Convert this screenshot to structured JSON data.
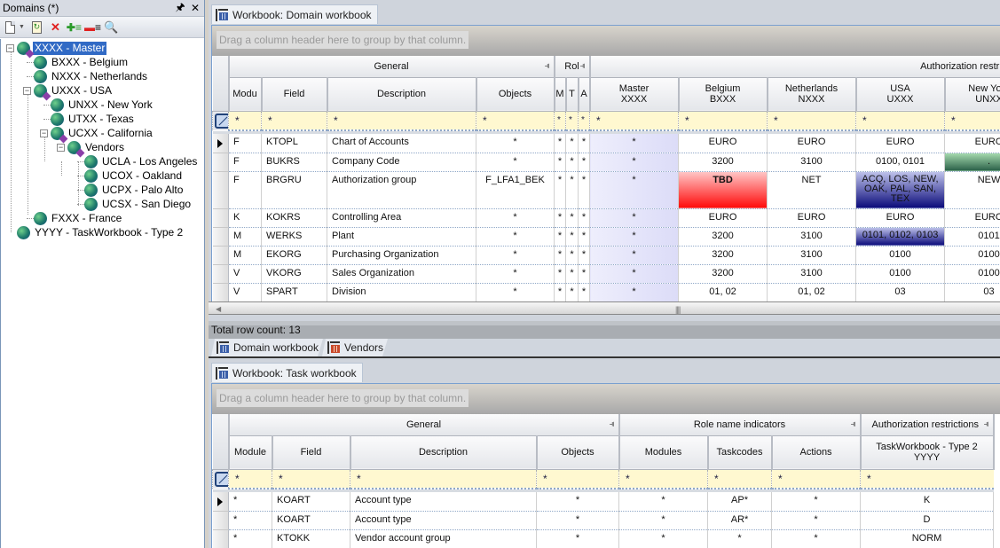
{
  "left_panel": {
    "title": "Domains (*)",
    "pin_label": "⊣",
    "close_label": "✕",
    "toolbar": [
      {
        "name": "new-button",
        "icon": "new-document-icon"
      },
      {
        "name": "refresh-button",
        "icon": "refresh-icon"
      },
      {
        "name": "delete-button",
        "icon": "delete-icon"
      },
      {
        "name": "add-button",
        "icon": "add-list-icon"
      },
      {
        "name": "remove-button",
        "icon": "remove-list-icon"
      },
      {
        "name": "inspect-button",
        "icon": "inspect-icon"
      }
    ],
    "tree": [
      {
        "label": "XXXX - Master",
        "level": 0,
        "expanded": true,
        "folder": true,
        "selected": true
      },
      {
        "label": "BXXX - Belgium",
        "level": 1
      },
      {
        "label": "NXXX - Netherlands",
        "level": 1
      },
      {
        "label": "UXXX - USA",
        "level": 1,
        "expanded": true,
        "folder": true
      },
      {
        "label": "UNXX - New York",
        "level": 2
      },
      {
        "label": "UTXX - Texas",
        "level": 2
      },
      {
        "label": "UCXX - California",
        "level": 2,
        "expanded": true,
        "folder": true
      },
      {
        "label": "Vendors",
        "level": 3,
        "expanded": true,
        "folder": true
      },
      {
        "label": "UCLA - Los Angeles",
        "level": 4
      },
      {
        "label": "UCOX - Oakland",
        "level": 4
      },
      {
        "label": "UCPX - Palo Alto",
        "level": 4
      },
      {
        "label": "UCSX - San Diego",
        "level": 4
      },
      {
        "label": "FXXX - France",
        "level": 1
      },
      {
        "label": "YYYY - TaskWorkbook - Type 2",
        "level": 0
      }
    ]
  },
  "domain_workbook": {
    "tab_label": "Workbook: Domain workbook",
    "group_hint": "Drag a column header here to group by that column.",
    "groups": {
      "general": "General",
      "roles": "Rol",
      "auth": "Authorization restrictions"
    },
    "columns": [
      "Modu",
      "Field",
      "Description",
      "Objects",
      "M",
      "T",
      "A",
      "Master\nXXXX",
      "Belgium\nBXXX",
      "Netherlands\nNXXX",
      "USA\nUXXX",
      "New York\nUNXX"
    ],
    "filter_value": "*",
    "rows": [
      {
        "cells": [
          "F",
          "KTOPL",
          "Chart of Accounts",
          "*",
          "*",
          "*",
          "*",
          "*",
          "EURO",
          "EURO",
          "EURO",
          "EURO"
        ],
        "current": true
      },
      {
        "cells": [
          "F",
          "BUKRS",
          "Company Code",
          "*",
          "*",
          "*",
          "*",
          "*",
          "3200",
          "3100",
          "0100, 0101",
          "."
        ]
      },
      {
        "cells": [
          "F",
          "BRGRU",
          "Authorization group",
          "F_LFA1_BEK",
          "*",
          "*",
          "*",
          "*",
          "TBD",
          "NET",
          "ACQ, LOS, NEW, OAK, PAL, SAN, TEX",
          "NEW"
        ]
      },
      {
        "cells": [
          "K",
          "KOKRS",
          "Controlling Area",
          "*",
          "*",
          "*",
          "*",
          "*",
          "EURO",
          "EURO",
          "EURO",
          "EURO"
        ]
      },
      {
        "cells": [
          "M",
          "WERKS",
          "Plant",
          "*",
          "*",
          "*",
          "*",
          "*",
          "3200",
          "3100",
          "0101, 0102, 0103",
          "0101"
        ]
      },
      {
        "cells": [
          "M",
          "EKORG",
          "Purchasing Organization",
          "*",
          "*",
          "*",
          "*",
          "*",
          "3200",
          "3100",
          "0100",
          "0100"
        ]
      },
      {
        "cells": [
          "V",
          "VKORG",
          "Sales Organization",
          "*",
          "*",
          "*",
          "*",
          "*",
          "3200",
          "3100",
          "0100",
          "0100"
        ]
      },
      {
        "cells": [
          "V",
          "SPART",
          "Division",
          "*",
          "*",
          "*",
          "*",
          "*",
          "01, 02",
          "01, 02",
          "03",
          "03"
        ]
      }
    ],
    "status": "Total row count: 13",
    "colors": {
      "tbd": "#ff0a0a",
      "multi": "#0a0a7a",
      "pending": "#2a6048",
      "master": "#dcdcf8"
    }
  },
  "bottom_tabs": [
    {
      "label": "Domain workbook",
      "active": true
    },
    {
      "label": "Vendors",
      "active": false
    }
  ],
  "task_workbook": {
    "tab_label": "Workbook: Task workbook",
    "group_hint": "Drag a column header here to group by that column.",
    "groups": {
      "general": "General",
      "roles": "Role name indicators",
      "auth": "Authorization restrictions"
    },
    "columns": [
      "Module",
      "Field",
      "Description",
      "Objects",
      "Modules",
      "Taskcodes",
      "Actions",
      "TaskWorkbook - Type 2\nYYYY"
    ],
    "filter_value": "*",
    "rows": [
      {
        "cells": [
          "*",
          "KOART",
          "Account type",
          "*",
          "*",
          "AP*",
          "*",
          "K"
        ],
        "current": true
      },
      {
        "cells": [
          "*",
          "KOART",
          "Account type",
          "*",
          "*",
          "AR*",
          "*",
          "D"
        ]
      },
      {
        "cells": [
          "*",
          "KTOKK",
          "Vendor account group",
          "*",
          "*",
          "*",
          "*",
          "NORM"
        ]
      }
    ]
  }
}
